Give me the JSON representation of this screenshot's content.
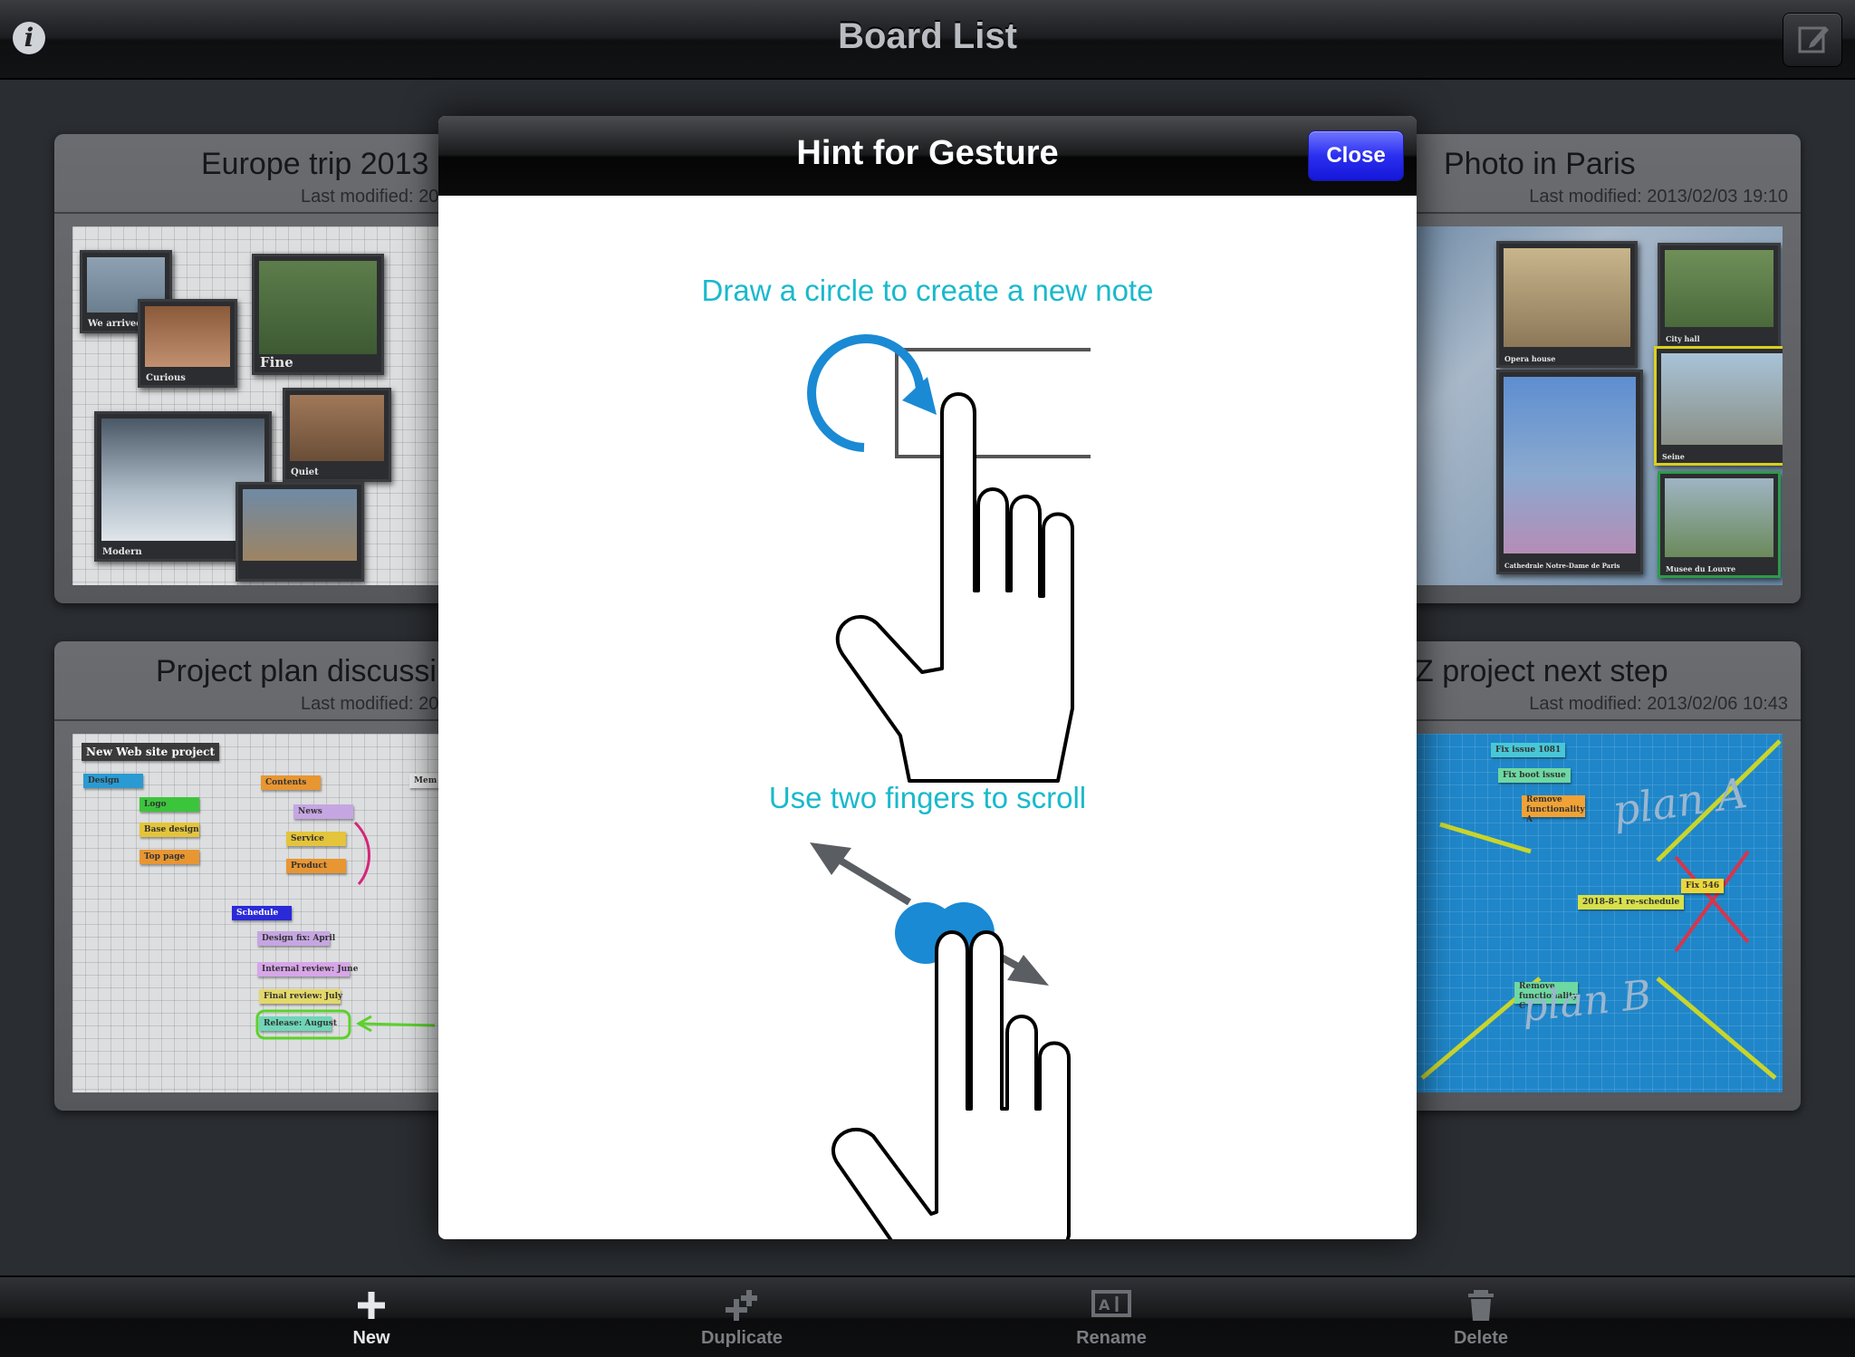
{
  "navbar": {
    "title": "Board List",
    "info_icon": "info-icon",
    "compose_icon": "compose-icon"
  },
  "boards": [
    {
      "title": "Europe trip 2013",
      "last_modified": "Last modified: 20"
    },
    {
      "title": "Photo in Paris",
      "last_modified": "Last modified: 2013/02/03 19:10"
    },
    {
      "title": "Project plan discussi",
      "last_modified": "Last modified: 20"
    },
    {
      "title": "Z project next step",
      "last_modified": "Last modified: 2013/02/06 10:43"
    }
  ],
  "europe_thumb": {
    "captions": [
      "We arrived Paris!",
      "Curious",
      "Fine",
      "Quiet",
      "Modern"
    ]
  },
  "paris_thumb": {
    "captions": [
      "Opera house",
      "City hall",
      "Seine",
      "Cathedrale Notre-Dame de Paris",
      "Musee du Louvre"
    ]
  },
  "project_thumb": {
    "title": "New Web site project",
    "notes": [
      "Design",
      "Logo",
      "Base design",
      "Top page",
      "Contents",
      "News",
      "Service",
      "Product",
      "Schedule",
      "Design fix: April",
      "Internal review: June",
      "Final review: July",
      "Release: August",
      "Mem"
    ]
  },
  "z_thumb": {
    "notes": [
      "Fix issue 1081",
      "Fix boot issue",
      "Remove functionality A",
      "Fix 546",
      "2018-8-1 re-schedule",
      "Remove functionality C"
    ],
    "handwriting": [
      "plan A",
      "plan B"
    ]
  },
  "modal": {
    "title": "Hint for Gesture",
    "close_label": "Close",
    "hint1": "Draw a circle to create a new note",
    "hint2": "Use two fingers to scroll"
  },
  "toolbar": {
    "items": [
      {
        "label": "New",
        "icon": "plus-icon",
        "enabled": true
      },
      {
        "label": "Duplicate",
        "icon": "duplicate-icon",
        "enabled": false
      },
      {
        "label": "Rename",
        "icon": "rename-icon",
        "enabled": false
      },
      {
        "label": "Delete",
        "icon": "trash-icon",
        "enabled": false
      }
    ]
  },
  "colors": {
    "hint_text": "#1ab9cc",
    "gesture_blue": "#1a8ad4",
    "close_button": "#2b2ff0"
  }
}
